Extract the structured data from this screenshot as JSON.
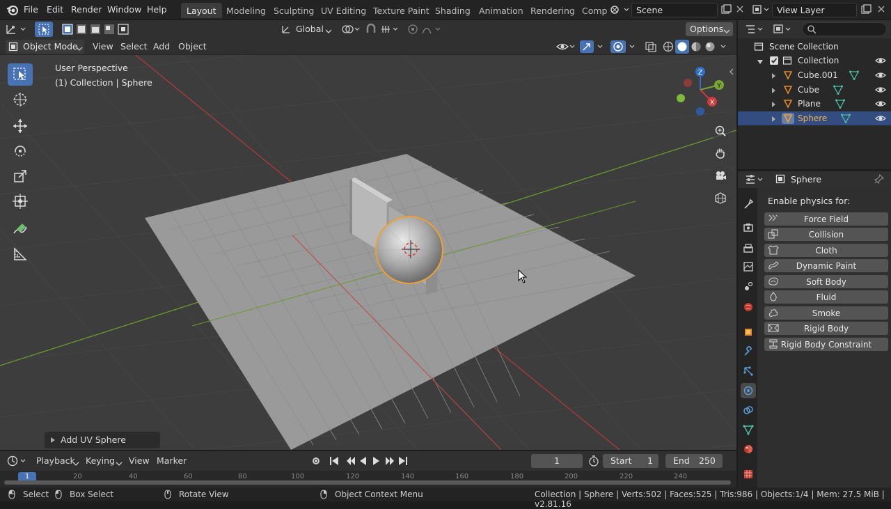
{
  "topbar": {
    "menus": [
      "File",
      "Edit",
      "Render",
      "Window",
      "Help"
    ],
    "workspaces": [
      "Layout",
      "Modeling",
      "Sculpting",
      "UV Editing",
      "Texture Paint",
      "Shading",
      "Animation",
      "Rendering",
      "Comp"
    ],
    "scene": "Scene",
    "view_layer": "View Layer"
  },
  "viewport_header": {
    "orientation": "Global",
    "options": "Options",
    "mode": "Object Mode",
    "menus": [
      "View",
      "Select",
      "Add",
      "Object"
    ]
  },
  "viewport": {
    "perspective": "User Perspective",
    "context": "(1) Collection | Sphere",
    "gizmo_axes": [
      "Z",
      "Y",
      "X"
    ]
  },
  "redo_panel": "Add UV Sphere",
  "outliner": {
    "root": "Scene Collection",
    "collection": "Collection",
    "objects": [
      "Cube.001",
      "Cube",
      "Plane",
      "Sphere"
    ],
    "selected": "Sphere"
  },
  "properties": {
    "object_name": "Sphere",
    "section_label": "Enable physics for:",
    "buttons": [
      "Force Field",
      "Collision",
      "Cloth",
      "Dynamic Paint",
      "Soft Body",
      "Fluid",
      "Smoke",
      "Rigid Body",
      "Rigid Body Constraint"
    ]
  },
  "timeline": {
    "menus": [
      "Playback",
      "Keying",
      "View",
      "Marker"
    ],
    "current_frame": "1",
    "start_label": "Start",
    "start": "1",
    "end_label": "End",
    "end": "250",
    "ticks": [
      "1",
      "20",
      "40",
      "60",
      "80",
      "100",
      "120",
      "140",
      "160",
      "180",
      "200",
      "220",
      "240"
    ]
  },
  "statusbar": {
    "select": "Select",
    "box_select": "Box Select",
    "rotate_view": "Rotate View",
    "context_menu": "Object Context Menu",
    "stats": "Collection | Sphere | Verts:502 | Faces:525 | Tris:986 | Objects:1/4 | Mem: 27.5 MiB | v2.81.16"
  },
  "colors": {
    "accent": "#4772b3",
    "selected_orange": "#f0a030",
    "x_axis": "#d03a3a",
    "y_axis": "#79a832",
    "z_axis": "#2f6fd0"
  }
}
